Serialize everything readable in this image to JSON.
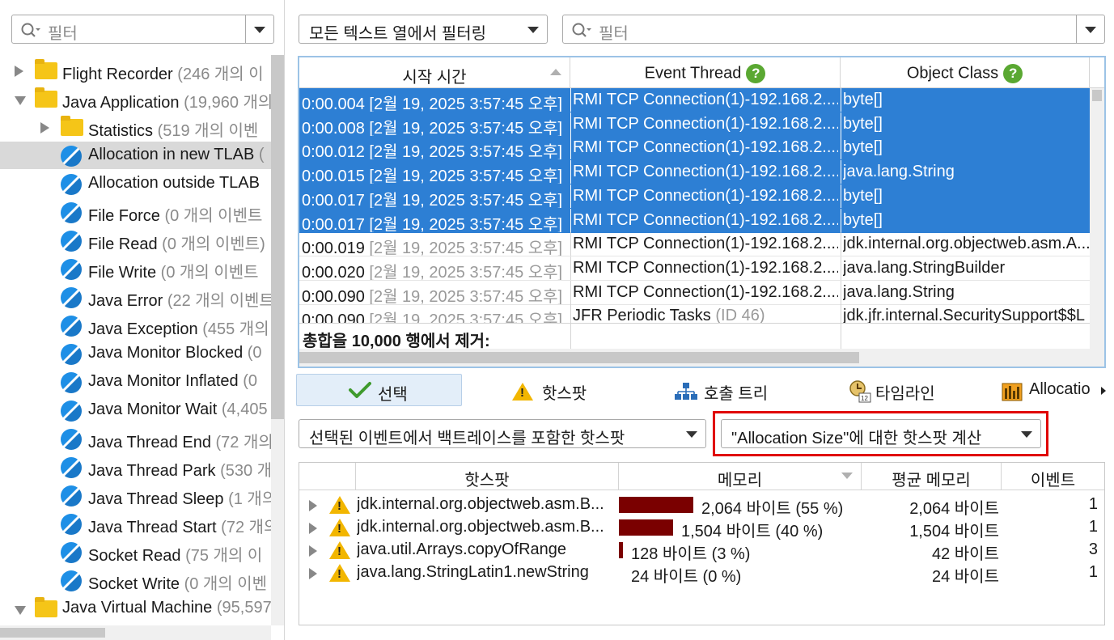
{
  "left_panel": {
    "filter_placeholder": "필터",
    "tree": [
      {
        "label": "Flight Recorder",
        "count": "(246 개의 이",
        "kind": "folder",
        "level": 0,
        "expander": "collapsed"
      },
      {
        "label": "Java Application",
        "count": "(19,960 개의",
        "kind": "folder",
        "level": 0,
        "expander": "expanded"
      },
      {
        "label": "Statistics",
        "count": "(519 개의 이벤",
        "kind": "folder",
        "level": 1,
        "expander": "collapsed"
      },
      {
        "label": "Allocation in new TLAB",
        "count": "(",
        "kind": "event",
        "level": 1,
        "selected": true
      },
      {
        "label": "Allocation outside TLAB",
        "count": "",
        "kind": "event",
        "level": 1
      },
      {
        "label": "File Force",
        "count": "(0 개의 이벤트",
        "kind": "event",
        "level": 1
      },
      {
        "label": "File Read",
        "count": "(0 개의 이벤트)",
        "kind": "event",
        "level": 1
      },
      {
        "label": "File Write",
        "count": "(0 개의 이벤트",
        "kind": "event",
        "level": 1
      },
      {
        "label": "Java Error",
        "count": "(22 개의 이벤트",
        "kind": "event",
        "level": 1
      },
      {
        "label": "Java Exception",
        "count": "(455 개의",
        "kind": "event",
        "level": 1
      },
      {
        "label": "Java Monitor Blocked",
        "count": "(0",
        "kind": "event",
        "level": 1
      },
      {
        "label": "Java Monitor Inflated",
        "count": "(0",
        "kind": "event",
        "level": 1
      },
      {
        "label": "Java Monitor Wait",
        "count": "(4,405",
        "kind": "event",
        "level": 1
      },
      {
        "label": "Java Thread End",
        "count": "(72 개의",
        "kind": "event",
        "level": 1
      },
      {
        "label": "Java Thread Park",
        "count": "(530 개",
        "kind": "event",
        "level": 1
      },
      {
        "label": "Java Thread Sleep",
        "count": "(1 개의",
        "kind": "event",
        "level": 1
      },
      {
        "label": "Java Thread Start",
        "count": "(72 개의",
        "kind": "event",
        "level": 1
      },
      {
        "label": "Socket Read",
        "count": "(75 개의 이",
        "kind": "event",
        "level": 1
      },
      {
        "label": "Socket Write",
        "count": "(0 개의 이벤",
        "kind": "event",
        "level": 1
      },
      {
        "label": "Java Virtual Machine",
        "count": "(95,597",
        "kind": "folder",
        "level": 0,
        "expander": "expanded"
      }
    ]
  },
  "top_bar": {
    "column_filter_label": "모든 텍스트 열에서 필터링",
    "filter_placeholder": "필터"
  },
  "events_table": {
    "columns": [
      "시작 시간",
      "Event Thread",
      "Object Class"
    ],
    "help_glyph": "?",
    "rows": [
      {
        "time": "0:00.004",
        "date": "[2월 19, 2025 3:57:45 오후]",
        "thread": "RMI TCP Connection(1)-192.168.2....",
        "thread_extra": "",
        "cls": "byte[]",
        "selected": true
      },
      {
        "time": "0:00.008",
        "date": "[2월 19, 2025 3:57:45 오후]",
        "thread": "RMI TCP Connection(1)-192.168.2....",
        "thread_extra": "",
        "cls": "byte[]",
        "selected": true
      },
      {
        "time": "0:00.012",
        "date": "[2월 19, 2025 3:57:45 오후]",
        "thread": "RMI TCP Connection(1)-192.168.2....",
        "thread_extra": "",
        "cls": "byte[]",
        "selected": true
      },
      {
        "time": "0:00.015",
        "date": "[2월 19, 2025 3:57:45 오후]",
        "thread": "RMI TCP Connection(1)-192.168.2....",
        "thread_extra": "",
        "cls": "java.lang.String",
        "selected": true
      },
      {
        "time": "0:00.017",
        "date": "[2월 19, 2025 3:57:45 오후]",
        "thread": "RMI TCP Connection(1)-192.168.2....",
        "thread_extra": "",
        "cls": "byte[]",
        "selected": true
      },
      {
        "time": "0:00.017",
        "date": "[2월 19, 2025 3:57:45 오후]",
        "thread": "RMI TCP Connection(1)-192.168.2....",
        "thread_extra": "",
        "cls": "byte[]",
        "selected": true
      },
      {
        "time": "0:00.019",
        "date": "[2월 19, 2025 3:57:45 오후]",
        "thread": "RMI TCP Connection(1)-192.168.2....",
        "thread_extra": "",
        "cls": "jdk.internal.org.objectweb.asm.A...",
        "selected": false
      },
      {
        "time": "0:00.020",
        "date": "[2월 19, 2025 3:57:45 오후]",
        "thread": "RMI TCP Connection(1)-192.168.2....",
        "thread_extra": "",
        "cls": "java.lang.StringBuilder",
        "selected": false
      },
      {
        "time": "0:00.090",
        "date": "[2월 19, 2025 3:57:45 오후]",
        "thread": "RMI TCP Connection(1)-192.168.2....",
        "thread_extra": "",
        "cls": "java.lang.String",
        "selected": false
      },
      {
        "time": "0:00.090",
        "date": "[2월 19, 2025 3:57:45 오후]",
        "thread": "JFR Periodic Tasks",
        "thread_extra": "(ID 46)",
        "cls": "jdk.jfr.internal.SecuritySupport$$L",
        "selected": false
      }
    ],
    "summary": "총합을 10,000 행에서 제거:"
  },
  "tabs": [
    {
      "label": "선택",
      "icon": "checkmark-icon",
      "active": true
    },
    {
      "label": "핫스팟",
      "icon": "warning-icon",
      "active": false
    },
    {
      "label": "호출 트리",
      "icon": "tree-icon",
      "active": false
    },
    {
      "label": "타임라인",
      "icon": "timeline-icon",
      "active": false
    },
    {
      "label": "Allocatio",
      "icon": "allocation-icon",
      "active": false
    }
  ],
  "hotspot_controls": {
    "mode_label": "선택된 이벤트에서 백트레이스를 포함한 핫스팟",
    "calc_label": "\"Allocation Size\"에 대한 핫스팟 계산"
  },
  "hotspot_table": {
    "columns": [
      "핫스팟",
      "메모리",
      "평균 메모리",
      "이벤트"
    ],
    "rows": [
      {
        "name": "jdk.internal.org.objectweb.asm.B...",
        "memory": "2,064 바이트 (55 %)",
        "share": 0.55,
        "avg": "2,064 바이트",
        "events": "1"
      },
      {
        "name": "jdk.internal.org.objectweb.asm.B...",
        "memory": "1,504 바이트 (40 %)",
        "share": 0.4,
        "avg": "1,504 바이트",
        "events": "1"
      },
      {
        "name": "java.util.Arrays.copyOfRange",
        "memory": "128 바이트 (3 %)",
        "share": 0.03,
        "avg": "42 바이트",
        "events": "3"
      },
      {
        "name": "java.lang.StringLatin1.newString",
        "memory": "24 바이트 (0 %)",
        "share": 0.0,
        "avg": "24 바이트",
        "events": "1"
      }
    ]
  },
  "colors": {
    "selection": "#2d7fd4",
    "highlight_border": "#e00000",
    "bar": "#7a0000",
    "help_badge": "#5aa832"
  }
}
